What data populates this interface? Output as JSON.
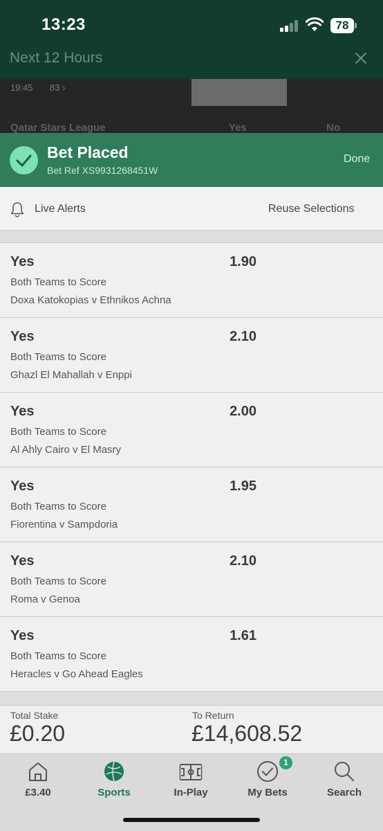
{
  "status_bar": {
    "time": "13:23",
    "battery": "78"
  },
  "overlay": {
    "title": "Next 12 Hours"
  },
  "background_row": {
    "time": "19:45",
    "count": "83",
    "league": "Qatar Stars League",
    "col_yes": "Yes",
    "col_no": "No"
  },
  "confirmation": {
    "title": "Bet Placed",
    "ref": "Bet Ref XS9931268451W",
    "done_label": "Done"
  },
  "actions": {
    "live_alerts": "Live Alerts",
    "reuse": "Reuse Selections"
  },
  "bets": [
    {
      "selection": "Yes",
      "odds": "1.90",
      "market": "Both Teams to Score",
      "event": "Doxa Katokopias v Ethnikos Achna"
    },
    {
      "selection": "Yes",
      "odds": "2.10",
      "market": "Both Teams to Score",
      "event": "Ghazl El Mahallah v Enppi"
    },
    {
      "selection": "Yes",
      "odds": "2.00",
      "market": "Both Teams to Score",
      "event": "Al Ahly Cairo v El Masry"
    },
    {
      "selection": "Yes",
      "odds": "1.95",
      "market": "Both Teams to Score",
      "event": "Fiorentina v Sampdoria"
    },
    {
      "selection": "Yes",
      "odds": "2.10",
      "market": "Both Teams to Score",
      "event": "Roma v Genoa"
    },
    {
      "selection": "Yes",
      "odds": "1.61",
      "market": "Both Teams to Score",
      "event": "Heracles v Go Ahead Eagles"
    }
  ],
  "totals": {
    "stake_label": "Total Stake",
    "stake_value": "£0.20",
    "return_label": "To Return",
    "return_value": "£14,608.52"
  },
  "tabs": [
    {
      "label": "£3.40",
      "icon": "home-icon"
    },
    {
      "label": "Sports",
      "icon": "football-icon"
    },
    {
      "label": "In-Play",
      "icon": "pitch-icon"
    },
    {
      "label": "My Bets",
      "icon": "check-circle-icon",
      "badge": "1"
    },
    {
      "label": "Search",
      "icon": "search-icon"
    }
  ],
  "colors": {
    "header": "#123d2c",
    "banner": "#2f7d5a",
    "accent": "#1b7a53",
    "badge": "#2aa371"
  }
}
